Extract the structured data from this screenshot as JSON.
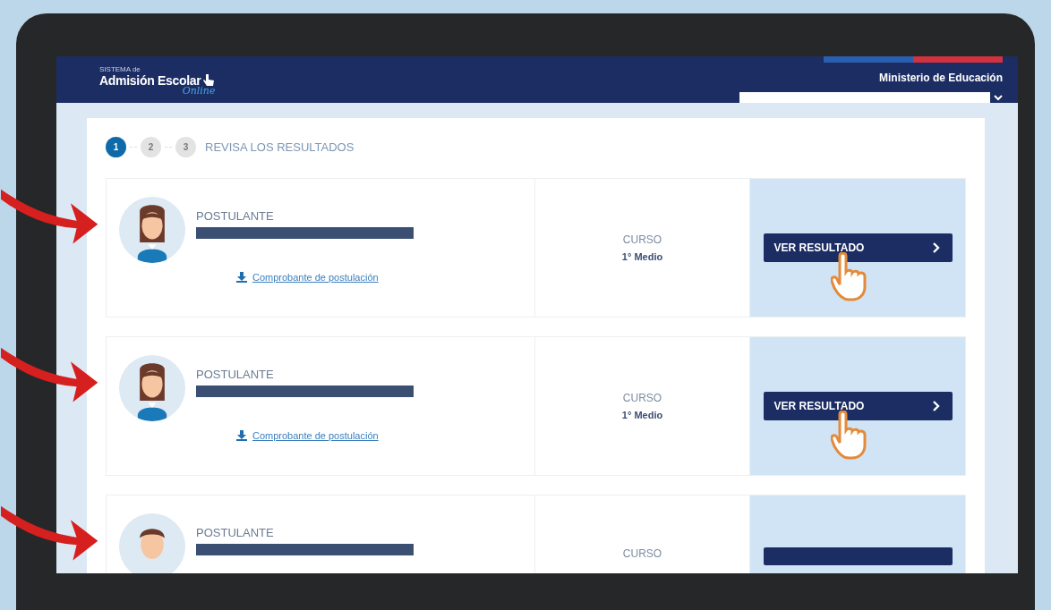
{
  "header": {
    "logo": {
      "small": "SISTEMA de",
      "main": "Admisión Escolar",
      "script": "Online"
    },
    "ministry": "Ministerio de Educación"
  },
  "stepper": {
    "steps": [
      {
        "label": "1",
        "selected": true
      },
      {
        "label": "2",
        "selected": false
      },
      {
        "label": "3",
        "selected": false
      }
    ],
    "title": "REVISA LOS RESULTADOS"
  },
  "applicants": [
    {
      "avatar": {
        "kind": "female"
      },
      "label": "POSTULANTE",
      "link": "Comprobante de postulación",
      "course_label": "CURSO",
      "course": "1° Medio",
      "button": "VER RESULTADO",
      "pointer": true
    },
    {
      "avatar": {
        "kind": "female"
      },
      "label": "POSTULANTE",
      "link": "Comprobante de postulación",
      "course_label": "CURSO",
      "course": "1° Medio",
      "button": "VER RESULTADO",
      "pointer": true
    },
    {
      "avatar": {
        "kind": "male"
      },
      "label": "POSTULANTE",
      "course_label": "CURSO",
      "pointer": false
    }
  ]
}
